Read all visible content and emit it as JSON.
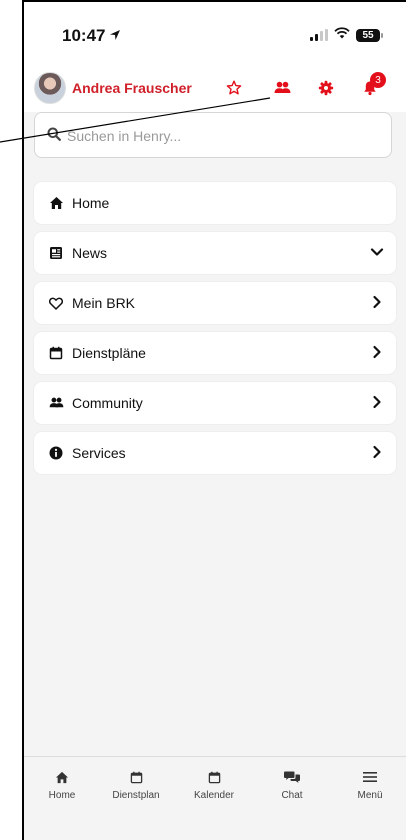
{
  "status_bar": {
    "time": "10:47",
    "battery": "55"
  },
  "header": {
    "user_name": "Andrea Frauscher",
    "notification_count": "3"
  },
  "search": {
    "placeholder": "Suchen in Henry..."
  },
  "menu": {
    "items": [
      {
        "label": "Home",
        "icon": "house-icon",
        "expander": "none"
      },
      {
        "label": "News",
        "icon": "newspaper-icon",
        "expander": "chevron-down-icon"
      },
      {
        "label": "Mein BRK",
        "icon": "heart-icon",
        "expander": "chevron-right-icon"
      },
      {
        "label": "Dienstpläne",
        "icon": "calendar-icon",
        "expander": "chevron-right-icon"
      },
      {
        "label": "Community",
        "icon": "users-icon",
        "expander": "chevron-right-icon"
      },
      {
        "label": "Services",
        "icon": "info-icon",
        "expander": "chevron-right-icon"
      }
    ]
  },
  "tabbar": {
    "items": [
      {
        "label": "Home",
        "icon": "house-icon"
      },
      {
        "label": "Dienstplan",
        "icon": "calendar-icon"
      },
      {
        "label": "Kalender",
        "icon": "calendar-icon"
      },
      {
        "label": "Chat",
        "icon": "chat-bubbles-icon"
      },
      {
        "label": "Menü",
        "icon": "hamburger-icon"
      }
    ]
  },
  "colors": {
    "accent": "#e3101c",
    "name_color": "#d0202a",
    "background": "#f4f4f5"
  }
}
